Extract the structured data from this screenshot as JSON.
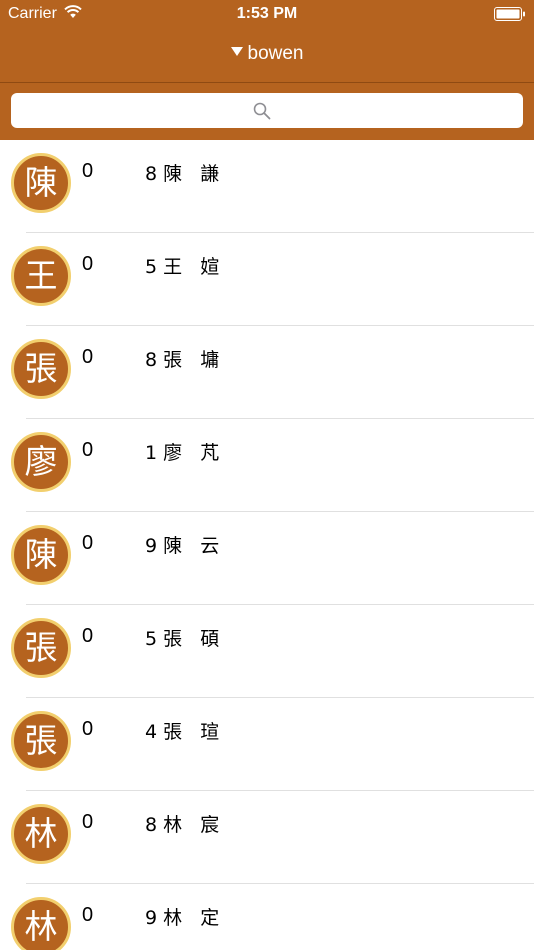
{
  "status_bar": {
    "carrier": "Carrier",
    "time": "1:53 PM"
  },
  "nav": {
    "title": "bowen"
  },
  "search": {
    "placeholder": ""
  },
  "colors": {
    "brand": "#b5631f",
    "avatar_ring": "#f2cf6e"
  },
  "contacts": [
    {
      "avatar": "陳",
      "phone": "0",
      "name": "8 陳   謙"
    },
    {
      "avatar": "王",
      "phone": "0",
      "name": "5 王   媗"
    },
    {
      "avatar": "張",
      "phone": "0",
      "name": "8 張   墉"
    },
    {
      "avatar": "廖",
      "phone": "0",
      "name": "1 廖   芃"
    },
    {
      "avatar": "陳",
      "phone": "0",
      "name": "9 陳   云"
    },
    {
      "avatar": "張",
      "phone": "0",
      "name": "5 張   碩"
    },
    {
      "avatar": "張",
      "phone": "0",
      "name": "4 張   瑄"
    },
    {
      "avatar": "林",
      "phone": "0",
      "name": "8 林   宸"
    },
    {
      "avatar": "林",
      "phone": "0",
      "name": "9 林   定"
    }
  ]
}
